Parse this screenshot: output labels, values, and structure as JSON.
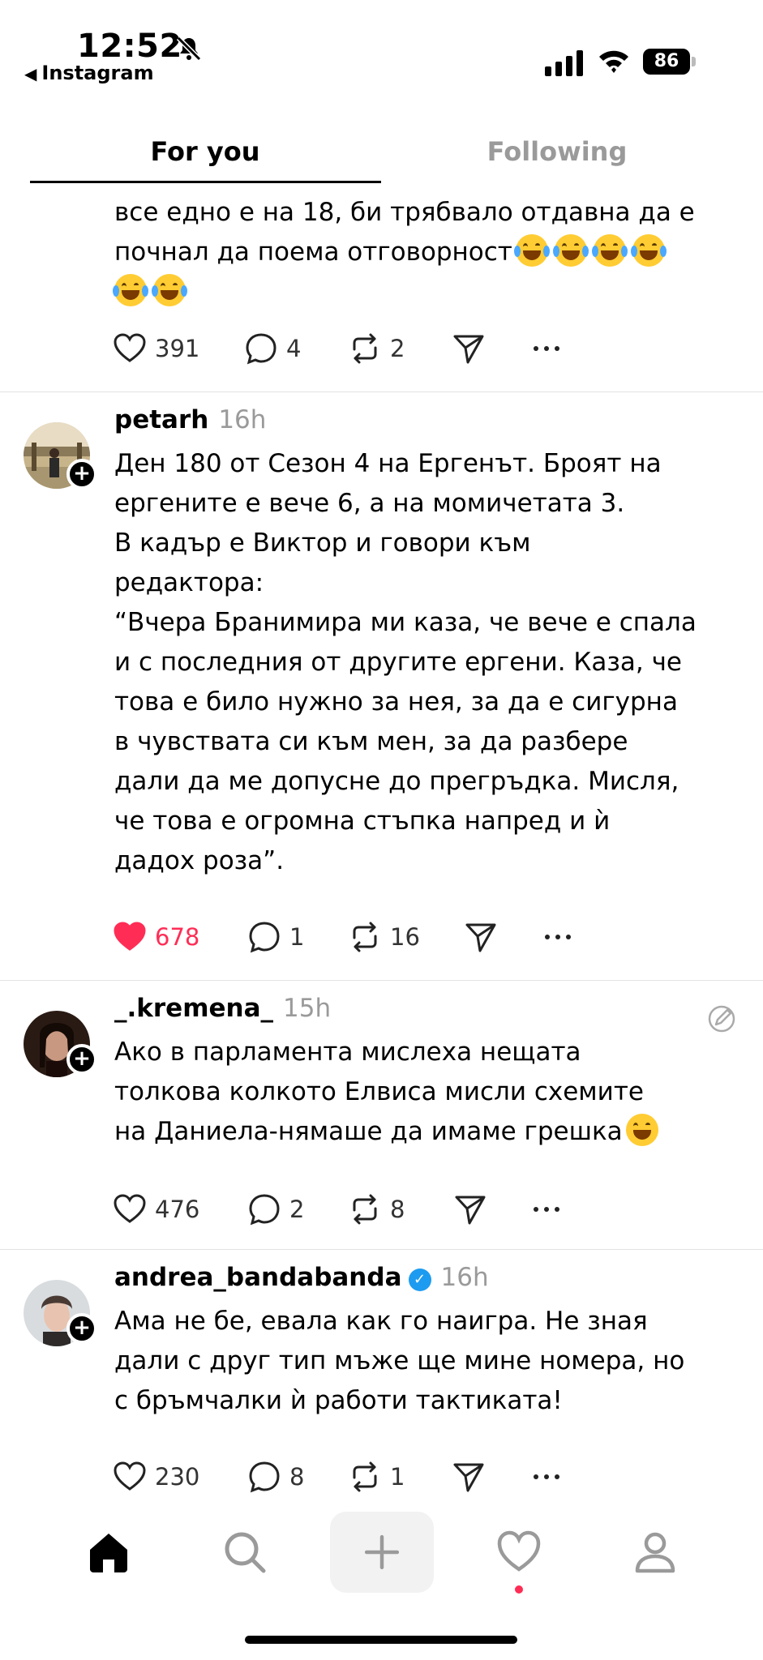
{
  "status_bar": {
    "time": "12:52",
    "back_app": "Instagram",
    "battery": "86"
  },
  "tabs": [
    {
      "label": "For you",
      "active": true
    },
    {
      "label": "Following",
      "active": false
    }
  ],
  "posts": [
    {
      "text_lines": [
        "все едно е на 18, би трябвало отдавна да е",
        "почнал да поема отговорност"
      ],
      "emoji_count_line2": 4,
      "emoji_count_line3": 2,
      "likes": "391",
      "replies": "4",
      "reposts": "2",
      "liked": false
    },
    {
      "username": "petarh",
      "time": "16h",
      "text": [
        "Ден 180 от Сезон 4 на Ергенът. Броят на",
        "ергените е вече 6, а на момичетата 3.",
        "В кадър е Виктор и говори към",
        "редактора:",
        "“Вчера Бранимира ми каза, че вече е спала",
        "и с последния от другите ергени. Каза, че",
        "това е било нужно за нея, за да е сигурна",
        "в чувствата си към мен, за да разбере",
        "дали да ме допусне до прегръдка. Мисля,",
        "че това е огромна стъпка напред и ѝ",
        "дадох роза”."
      ],
      "likes": "678",
      "replies": "1",
      "reposts": "16",
      "liked": true
    },
    {
      "username": "_.kremena_",
      "time": "15h",
      "text": [
        "Ако в парламента мислеха нещата",
        "толкова колкото Елвиса мисли схемите",
        "на Даниела-нямаше да имаме грешка"
      ],
      "likes": "476",
      "replies": "2",
      "reposts": "8",
      "liked": false
    },
    {
      "username": "andrea_bandabanda",
      "verified": true,
      "time": "16h",
      "text": [
        "Ама не бе, евала как го наигра. Не зная",
        "дали с друг тип мъже ще мине номера, но",
        "с бръмчалки ѝ работи тактиката!"
      ],
      "likes": "230",
      "replies": "8",
      "reposts": "1",
      "liked": false
    }
  ],
  "colors": {
    "like_active": "#ff2d55",
    "muted": "#9a9a9a",
    "verified": "#1d9bf0"
  },
  "nav_icons": [
    "home-icon",
    "search-icon",
    "plus-icon",
    "heart-icon",
    "profile-icon"
  ]
}
